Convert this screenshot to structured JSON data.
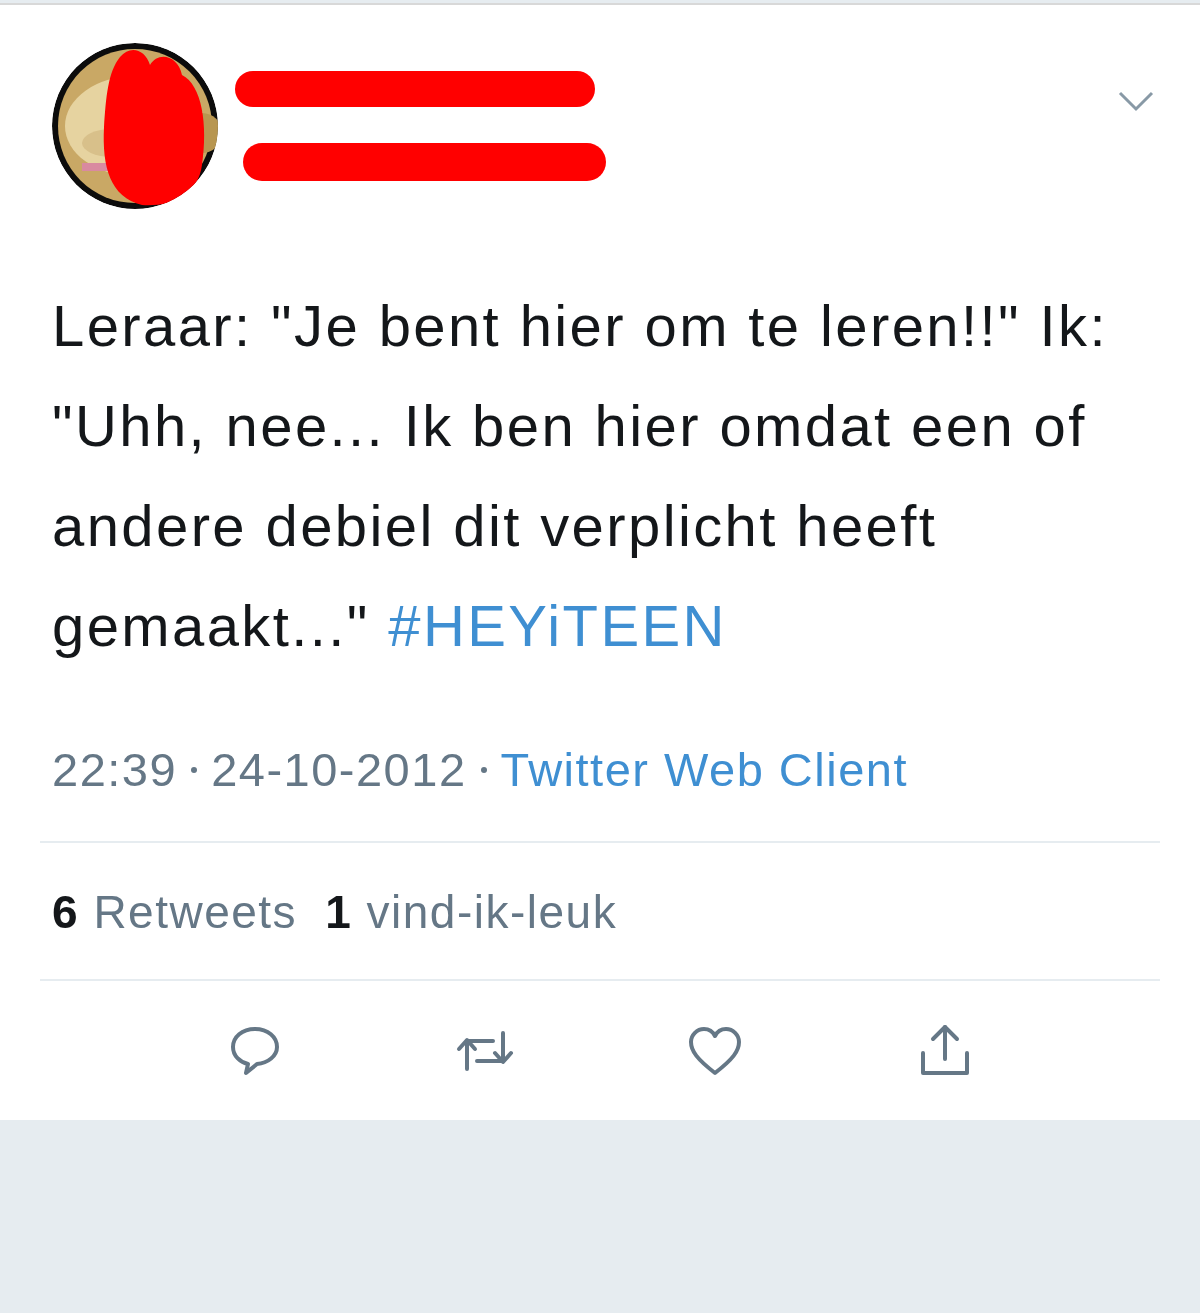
{
  "tweet": {
    "avatar": {
      "kind": "picture",
      "redacted": true
    },
    "name_redacted": true,
    "handle_redacted": true,
    "text": "Leraar: \"Je bent hier om te leren!!\" Ik: \"Uhh, nee... Ik ben hier omdat een of andere debiel dit verplicht heeft gemaakt...\"",
    "hashtag": "#HEYiTEEN",
    "time": "22:39",
    "date": "24-10-2012",
    "source": "Twitter Web Client",
    "stats": [
      {
        "count": "6",
        "label": "Retweets"
      },
      {
        "count": "1",
        "label": "vind-ik-leuk"
      }
    ],
    "actions": [
      {
        "kind": "reply"
      },
      {
        "kind": "retweet"
      },
      {
        "kind": "like"
      },
      {
        "kind": "share"
      }
    ]
  }
}
